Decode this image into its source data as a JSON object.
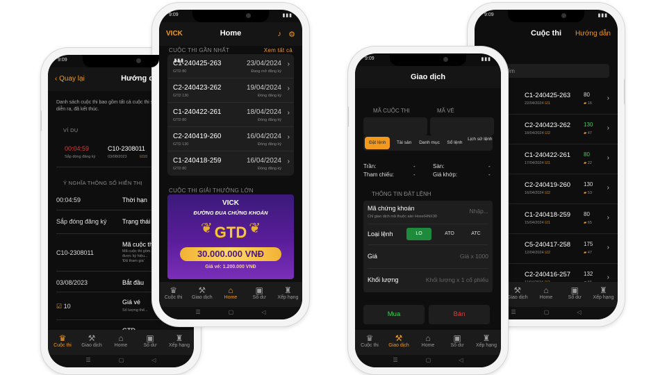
{
  "colors": {
    "accent": "#f39a1e",
    "danger": "#e23b3b",
    "success": "#3ecf5a",
    "background": "#0e0e0e"
  },
  "status_time": "9:09",
  "tabbar": [
    {
      "label": "Cuộc thi",
      "icon": "trophy-icon"
    },
    {
      "label": "Giao dịch",
      "icon": "gavel-icon"
    },
    {
      "label": "Home",
      "icon": "home-icon"
    },
    {
      "label": "Số dư",
      "icon": "wallet-icon"
    },
    {
      "label": "Xếp hạng",
      "icon": "ranking-icon"
    }
  ],
  "guide": {
    "back_label": "Quay lại",
    "title": "Hướng dẫn",
    "description": "Danh sách cuộc thi bao gồm tất cả cuộc thi sắp diễn ra, đang diễn ra, đã kết thúc.",
    "example_section": "VÍ DỤ",
    "example": {
      "countdown": "00:04:59",
      "status": "Sắp đóng đăng ký",
      "code": "C10-2308011",
      "date": "03/08/2023",
      "slots": "10"
    },
    "meaning_section": "Ý NGHĨA THÔNG SỐ HIỂN THỊ",
    "rows": [
      {
        "left": "00:04:59",
        "right": "Thời hạn",
        "note": ""
      },
      {
        "left": "Sắp đóng đăng ký",
        "right": "Trạng thái",
        "note": ""
      },
      {
        "left": "C10-2308011",
        "right": "Mã cuộc thi",
        "note": "Mã cuộc thi gồm... được ký hiệu... 'Đã tham gia'"
      },
      {
        "left": "03/08/2023",
        "right": "Bắt đầu",
        "note": ""
      },
      {
        "left": "10",
        "right": "Giá vé",
        "note": "Số lượng thể..."
      },
      {
        "left": "",
        "right": "GTD",
        "note": ""
      }
    ]
  },
  "home": {
    "logo": "VICK",
    "title": "Home",
    "recent_section": "CUỘC THI GẦN NHẤT",
    "see_all": "Xem tất cả",
    "contests": [
      {
        "code": "C1-240425-263",
        "fee": "GTD 80",
        "date": "23/04/2024",
        "status": "Đang mở đăng ký"
      },
      {
        "code": "C2-240423-262",
        "fee": "GTD 130",
        "date": "19/04/2024",
        "status": "Đóng đăng ký"
      },
      {
        "code": "C1-240422-261",
        "fee": "GTD 80",
        "date": "18/04/2024",
        "status": "Đóng đăng ký"
      },
      {
        "code": "C2-240419-260",
        "fee": "GTD 130",
        "date": "16/04/2024",
        "status": "Đóng đăng ký"
      },
      {
        "code": "C1-240418-259",
        "fee": "GTD 80",
        "date": "16/04/2024",
        "status": "Đóng đăng ký"
      }
    ],
    "prize_section": "CUỘC THI GIẢI THƯỞNG LỚN",
    "banner": {
      "logo": "VICK",
      "slogan": "ĐƯỜNG ĐUA CHỨNG KHOÁN",
      "badge": "GTD",
      "prize": "30.000.000 VNĐ",
      "fee": "Giá vé: 1.200.000 VNĐ"
    }
  },
  "trade": {
    "title": "Giao dịch",
    "contest_label": "MÃ CUỘC THI",
    "ticket_label": "MÃ VÉ",
    "tabs": [
      "Đặt lệnh",
      "Tài sản",
      "Danh mục",
      "Sổ lệnh",
      "Lịch sử lệnh"
    ],
    "ceiling": "Trần:",
    "floor": "Sàn:",
    "reference": "Tham chiếu:",
    "matched": "Giá khớp:",
    "dash": "-",
    "order_section": "THÔNG TIN ĐẶT LỆNH",
    "symbol_label": "Mã chứng khoán",
    "symbol_hint": "Chỉ giao dịch mã thuộc sàn Hose/HNX30",
    "symbol_placeholder": "Nhập...",
    "order_type_label": "Loại lệnh",
    "order_types": [
      "LO",
      "ATO",
      "ATC"
    ],
    "price_label": "Giá",
    "price_placeholder": "Giá x 1000",
    "qty_label": "Khối lượng",
    "qty_placeholder": "Khối lượng x 1 cổ phiếu",
    "buy": "Mua",
    "sell": "Bán"
  },
  "contests": {
    "title": "Cuộc thi",
    "guide_link": "Hướng dẫn",
    "search_placeholder": "kiếm",
    "rows": [
      {
        "prefix": "24",
        "code": "C1-240425-263",
        "date": "22/04/2024",
        "slots": "1",
        "count": "80",
        "count_color": "default",
        "sub": "16"
      },
      {
        "prefix": "24",
        "code": "C2-240423-262",
        "date": "18/04/2024",
        "slots": "2",
        "count": "130",
        "count_color": "green",
        "sub": "47"
      },
      {
        "prefix": "24",
        "code": "C1-240422-261",
        "date": "17/04/2024",
        "slots": "1",
        "count": "80",
        "count_color": "green",
        "sub": "22"
      },
      {
        "prefix": "24",
        "code": "C2-240419-260",
        "date": "16/04/2024",
        "slots": "2",
        "count": "130",
        "count_color": "default",
        "sub": "53"
      },
      {
        "prefix": "24",
        "code": "C1-240418-259",
        "date": "15/04/2024",
        "slots": "1",
        "count": "80",
        "count_color": "default",
        "sub": "65"
      },
      {
        "prefix": "24",
        "code": "C5-240417-258",
        "date": "12/04/2024",
        "slots": "2",
        "count": "175",
        "count_color": "default",
        "sub": "47"
      },
      {
        "prefix": "24",
        "code": "C2-240416-257",
        "date": "11/04/2024",
        "slots": "2",
        "count": "132",
        "count_color": "default",
        "sub": "66"
      }
    ]
  }
}
